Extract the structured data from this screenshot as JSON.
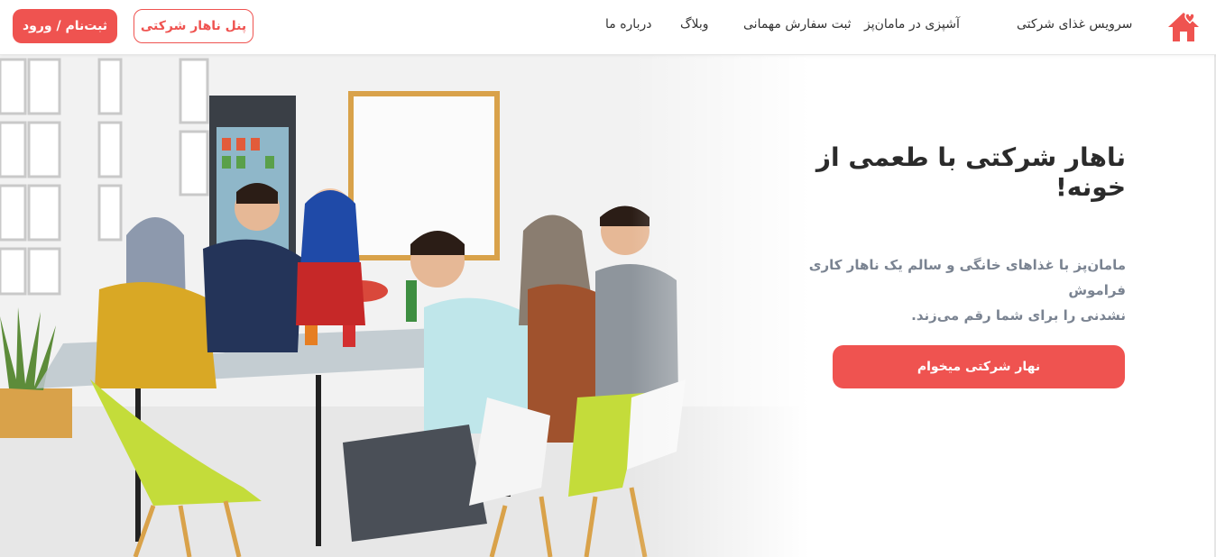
{
  "header": {
    "logo_icon": "home-heart-icon",
    "brand_color": "#ef5350",
    "nav": {
      "corporate_food": "سرویس غذای شرکتی",
      "cooking": "آشپزی در مامان‌پز",
      "party_order": "ثبت سفارش مهمانی",
      "blog": "وبلاگ",
      "about": "درباره ما"
    },
    "panel_button": "پنل ناهار شرکتی",
    "login_button": "ثبت‌نام / ورود"
  },
  "hero": {
    "title": "ناهار شرکتی با طعمی از خونه!",
    "description_line1": "مامان‌پز با غذاهای خانگی و سالم یک ناهار کاری فراموش",
    "description_line2": "نشدنی را برای شما رقم می‌زند.",
    "cta_button": "نهار شرکتی میخوام",
    "image": "office-lunch-photo"
  }
}
